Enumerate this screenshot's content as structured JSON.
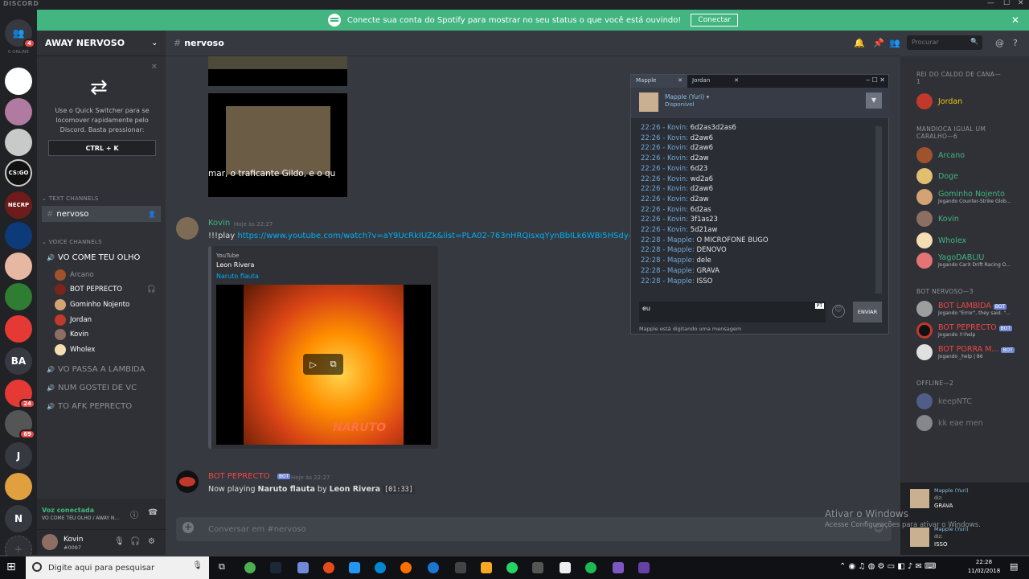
{
  "window": {
    "brand": "DISCORD"
  },
  "banner": {
    "text": "Conecte sua conta do Spotify para mostrar no seu status o que você está ouvindo!",
    "button": "Conectar"
  },
  "guilds": {
    "online": "0 ONLINE",
    "home_badge": "4",
    "ba": "BA",
    "j": "J",
    "n": "N",
    "badge24": "24",
    "badge69": "69"
  },
  "server": {
    "name": "AWAY NERVOSO"
  },
  "quick_switcher": {
    "text": "Use o Quick Switcher para se locomover rapidamente pelo Discord. Basta pressionar:",
    "shortcut": "CTRL + K"
  },
  "channels": {
    "text_header": "TEXT CHANNELS",
    "text_channel": "nervoso",
    "voice_header": "VOICE CHANNELS",
    "voice_active": "VO COME TEU OLHO",
    "voice_users": [
      "Arcano",
      "BOT PEPRECTO",
      "Gominho Nojento",
      "Jordan",
      "Kovin",
      "Wholex"
    ],
    "voice_others": [
      "VO PASSA A LAMBIDA",
      "NUM GOSTEI DE VC",
      "TO AFK PEPRECTO"
    ]
  },
  "voice_status": {
    "title": "Voz conectada",
    "sub": "VO COME TEU OLHO / AWAY N..."
  },
  "user": {
    "name": "Kovin",
    "tag": "#0097"
  },
  "chat": {
    "channel": "nervoso",
    "search_placeholder": "Procurar",
    "video_caption": "mar, o traficante Gildo, e o qu",
    "msg1": {
      "author": "Kovin",
      "time": "Hoje às 22:27",
      "prefix": "!!!play ",
      "link": "https://www.youtube.com/watch?v=aY9UcRkIUZk&list=PLA02-763nHRQisxqYynBbILk6WBi5HSdy&inde"
    },
    "embed": {
      "provider": "YouTube",
      "author": "Leon Rivera",
      "title": "Naruto flauta",
      "overlay": "NARUTO"
    },
    "msg2": {
      "author": "BOT PEPRECTO",
      "badge": "BOT",
      "time": "Hoje às 22:27",
      "p1": "Now playing ",
      "song": "Naruto flauta",
      "p2": " by ",
      "artist": "Leon Rivera",
      "dur": "[01:33]"
    },
    "input_placeholder": "Conversar em #nervoso"
  },
  "steam": {
    "tabs": [
      "Mapple",
      "Jordan"
    ],
    "user": "Mapple (Yuri)",
    "status": "Disponível",
    "log": [
      [
        "22:26 - Kovin:",
        "6d2as3d2as6"
      ],
      [
        "22:26 - Kovin:",
        "d2aw6"
      ],
      [
        "22:26 - Kovin:",
        "d2aw6"
      ],
      [
        "22:26 - Kovin:",
        "d2aw"
      ],
      [
        "22:26 - Kovin:",
        "6d23"
      ],
      [
        "22:26 - Kovin:",
        "wd2a6"
      ],
      [
        "22:26 - Kovin:",
        "d2aw6"
      ],
      [
        "22:26 - Kovin:",
        "d2aw"
      ],
      [
        "22:26 - Kovin:",
        "6d2as"
      ],
      [
        "22:26 - Kovin:",
        "3f1as23"
      ],
      [
        "22:26 - Kovin:",
        "5d21aw"
      ],
      [
        "22:28 - Mapple:",
        "O MICROFONE BUGO"
      ],
      [
        "22:28 - Mapple:",
        "DENOVO"
      ],
      [
        "22:28 - Mapple:",
        "dele"
      ],
      [
        "22:28 - Mapple:",
        "GRAVA"
      ],
      [
        "22:28 - Mapple:",
        "ISSO"
      ]
    ],
    "input": "eu",
    "lang": "PT",
    "send": "ENVIAR",
    "typing": "Mapple está digitando uma mensagem"
  },
  "members": {
    "cat1": "REI DO CALDO DE CANA—1",
    "cat2": "MANDIOCA IGUAL UM CARALHO—6",
    "cat3": "BOT NERVOSO—3",
    "cat4": "OFFLINE—2",
    "g1": [
      {
        "name": "Jordan",
        "color": "#f1c40f"
      }
    ],
    "g2": [
      {
        "name": "Arcano",
        "sub": ""
      },
      {
        "name": "Doge",
        "sub": ""
      },
      {
        "name": "Gominho Nojento",
        "sub": "Jogando Counter-Strike Glob..."
      },
      {
        "name": "Kovin",
        "sub": ""
      },
      {
        "name": "Wholex",
        "sub": ""
      },
      {
        "name": "YagoDABLIU",
        "sub": "Jogando CarX Drift Racing O..."
      }
    ],
    "g3": [
      {
        "name": "BOT LAMBIDA",
        "sub": "Jogando \"Error\", they said. \"..."
      },
      {
        "name": "BOT PEPRECTO",
        "sub": "Jogando !!!help"
      },
      {
        "name": "BOT PORRA M...",
        "sub": "Jogando _help | 86"
      }
    ],
    "g4": [
      {
        "name": "keepNTC"
      },
      {
        "name": "kk eae men"
      }
    ],
    "bot_badge": "BOT"
  },
  "notifications": [
    {
      "name": "Mapple (Yuri)",
      "diz": "diz:",
      "msg": "GRAVA"
    },
    {
      "name": "Mapple (Yuri)",
      "diz": "diz:",
      "msg": "ISSO"
    }
  ],
  "activation": {
    "title": "Ativar o Windows",
    "sub": "Acesse Configurações para ativar o Windows."
  },
  "taskbar": {
    "search": "Digite aqui para pesquisar",
    "time": "22:28",
    "date": "11/02/2018"
  }
}
